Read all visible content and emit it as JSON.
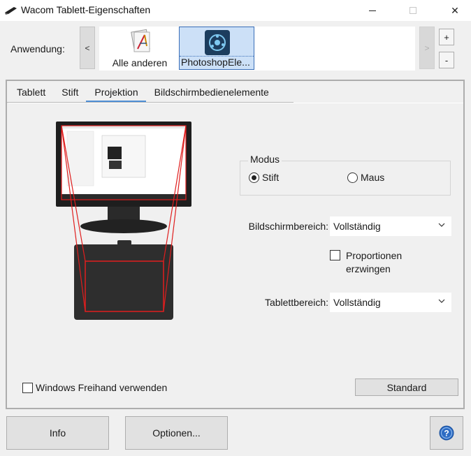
{
  "window": {
    "title": "Wacom Tablett-Eigenschaften",
    "close_glyph": "✕"
  },
  "application": {
    "label": "Anwendung:",
    "prev_glyph": "<",
    "next_glyph": ">",
    "add_glyph": "+",
    "remove_glyph": "-",
    "apps": [
      {
        "label": "Alle anderen",
        "icon": "all-apps-icon"
      },
      {
        "label": "PhotoshopEle...",
        "icon": "photoshop-elements-icon",
        "selected": true
      }
    ]
  },
  "tabs": [
    {
      "label": "Tablett"
    },
    {
      "label": "Stift"
    },
    {
      "label": "Projektion",
      "active": true
    },
    {
      "label": "Bildschirmbedienelemente"
    }
  ],
  "projection": {
    "mode_group": {
      "legend": "Modus",
      "options": [
        {
          "label": "Stift",
          "selected": true
        },
        {
          "label": "Maus",
          "selected": false
        }
      ]
    },
    "screen_area": {
      "label": "Bildschirmbereich:",
      "value": "Vollständig"
    },
    "force_proportions": {
      "label_line1": "Proportionen",
      "label_line2": "erzwingen",
      "checked": false
    },
    "tablet_area": {
      "label": "Tablettbereich:",
      "value": "Vollständig"
    },
    "windows_ink": {
      "label": "Windows Freihand verwenden",
      "checked": false
    },
    "default_button": "Standard"
  },
  "footer": {
    "info_button": "Info",
    "options_button": "Optionen...",
    "help_icon": "help-icon"
  },
  "colors": {
    "accent": "#4f8fd6",
    "mapping_red": "#e01e1e",
    "help_blue": "#2d6cc4"
  }
}
